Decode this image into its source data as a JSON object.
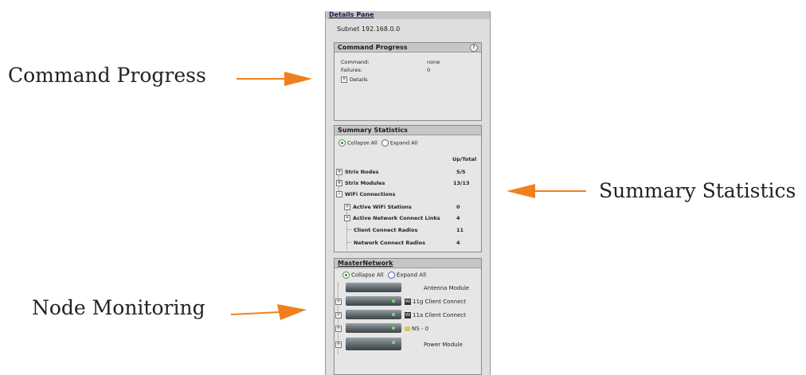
{
  "callouts": {
    "command_progress": "Command Progress",
    "summary_statistics": "Summary Statistics",
    "node_monitoring": "Node Monitoring"
  },
  "colors": {
    "arrow": "#f07f1e",
    "panel_bg": "#dedede",
    "header_bg": "#c6c6c6",
    "green_led": "#6fd46f"
  },
  "pane": {
    "title": "Details Pane",
    "subnet": "Subnet 192.168.0.0"
  },
  "command_progress": {
    "title": "Command Progress",
    "help_icon": "?",
    "command_label": "Command:",
    "command_value": "none",
    "failures_label": "Failures:",
    "failures_value": "0",
    "details_label": "Details",
    "expander": "+"
  },
  "summary": {
    "title": "Summary Statistics",
    "collapse_all": "Collapse All",
    "expand_all": "Expand All",
    "column_header": "Up/Total",
    "rows": [
      {
        "label": "Strix Nodes",
        "value": "5/5",
        "expander": "+"
      },
      {
        "label": "Strix Modules",
        "value": "13/13",
        "expander": "+"
      },
      {
        "label": "WiFi Connections",
        "value": "",
        "expander": "-"
      },
      {
        "label": "Active WiFi Stations",
        "value": "0",
        "expander": "+"
      },
      {
        "label": "Active Network Connect Links",
        "value": "4",
        "expander": "+"
      },
      {
        "label": "Client Connect Radios",
        "value": "11",
        "expander": ""
      },
      {
        "label": "Network Connect Radios",
        "value": "4",
        "expander": ""
      }
    ]
  },
  "network": {
    "title": "MasterNetwork",
    "collapse_all": "Collapse All",
    "expand_all": "Expand All",
    "nodes": [
      {
        "label": "Antenna Module",
        "badge": "",
        "expander": ""
      },
      {
        "label": "11g Client Connect",
        "badge": "wifi",
        "badge_text": "Wi",
        "expander": "+"
      },
      {
        "label": "11a Client Connect",
        "badge": "wifi",
        "badge_text": "Wi",
        "expander": "+"
      },
      {
        "label": "NS - 0",
        "badge": "ns",
        "badge_text": "",
        "expander": "+"
      },
      {
        "label": "Power Module",
        "badge": "",
        "expander": "+"
      }
    ]
  }
}
